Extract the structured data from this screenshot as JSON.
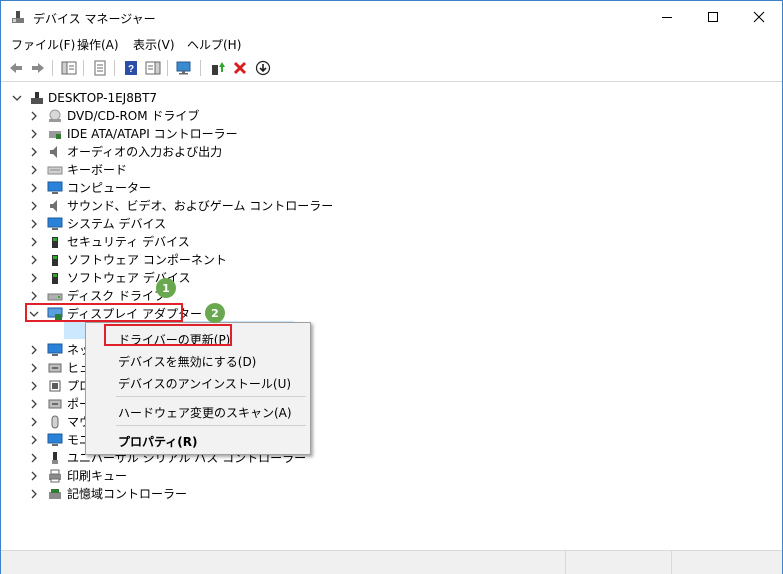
{
  "window": {
    "title": "デバイス マネージャー"
  },
  "menu": [
    "ファイル(F)",
    "操作(A)",
    "表示(V)",
    "ヘルプ(H)"
  ],
  "tree": {
    "root": "DESKTOP-1EJ8BT7",
    "items": [
      {
        "label": "DVD/CD-ROM ドライブ",
        "icon": "dvd-drive-icon"
      },
      {
        "label": "IDE ATA/ATAPI コントローラー",
        "icon": "ide-controller-icon"
      },
      {
        "label": "オーディオの入力および出力",
        "icon": "speaker-icon"
      },
      {
        "label": "キーボード",
        "icon": "keyboard-icon"
      },
      {
        "label": "コンピューター",
        "icon": "computer-icon"
      },
      {
        "label": "サウンド、ビデオ、およびゲーム コントローラー",
        "icon": "sound-icon"
      },
      {
        "label": "システム デバイス",
        "icon": "system-device-icon"
      },
      {
        "label": "セキュリティ デバイス",
        "icon": "security-device-icon"
      },
      {
        "label": "ソフトウェア コンポーネント",
        "icon": "software-component-icon"
      },
      {
        "label": "ソフトウェア デバイス",
        "icon": "software-device-icon"
      },
      {
        "label": "ディスク ドライブ",
        "icon": "disk-drive-icon"
      },
      {
        "label": "ディスプレイ アダプター",
        "icon": "display-adapter-icon"
      },
      {
        "label": "",
        "icon": "display-adapter-child-icon"
      },
      {
        "label": "ネッ",
        "icon": "network-icon"
      },
      {
        "label": "ヒュ",
        "icon": "hid-icon"
      },
      {
        "label": "プロ",
        "icon": "processor-icon"
      },
      {
        "label": "ポー",
        "icon": "port-icon"
      },
      {
        "label": "マウ",
        "icon": "mouse-icon"
      },
      {
        "label": "モニ",
        "icon": "monitor-icon"
      },
      {
        "label": "ユニバーサル シリアル バス コントローラー",
        "icon": "usb-icon"
      },
      {
        "label": "印刷キュー",
        "icon": "print-queue-icon"
      },
      {
        "label": "記憶域コントローラー",
        "icon": "storage-controller-icon"
      }
    ]
  },
  "context_menu": {
    "items": [
      {
        "label": "ドライバーの更新(P)",
        "bold": false
      },
      {
        "label": "デバイスを無効にする(D)",
        "bold": false
      },
      {
        "label": "デバイスのアンインストール(U)",
        "bold": false
      },
      {
        "label": "ハードウェア変更のスキャン(A)",
        "bold": false
      },
      {
        "label": "プロパティ(R)",
        "bold": true
      }
    ]
  },
  "annotations": {
    "badge1": "1",
    "badge2": "2",
    "color_badge": "#6aa84f",
    "color_highlight": "#e0202a"
  }
}
